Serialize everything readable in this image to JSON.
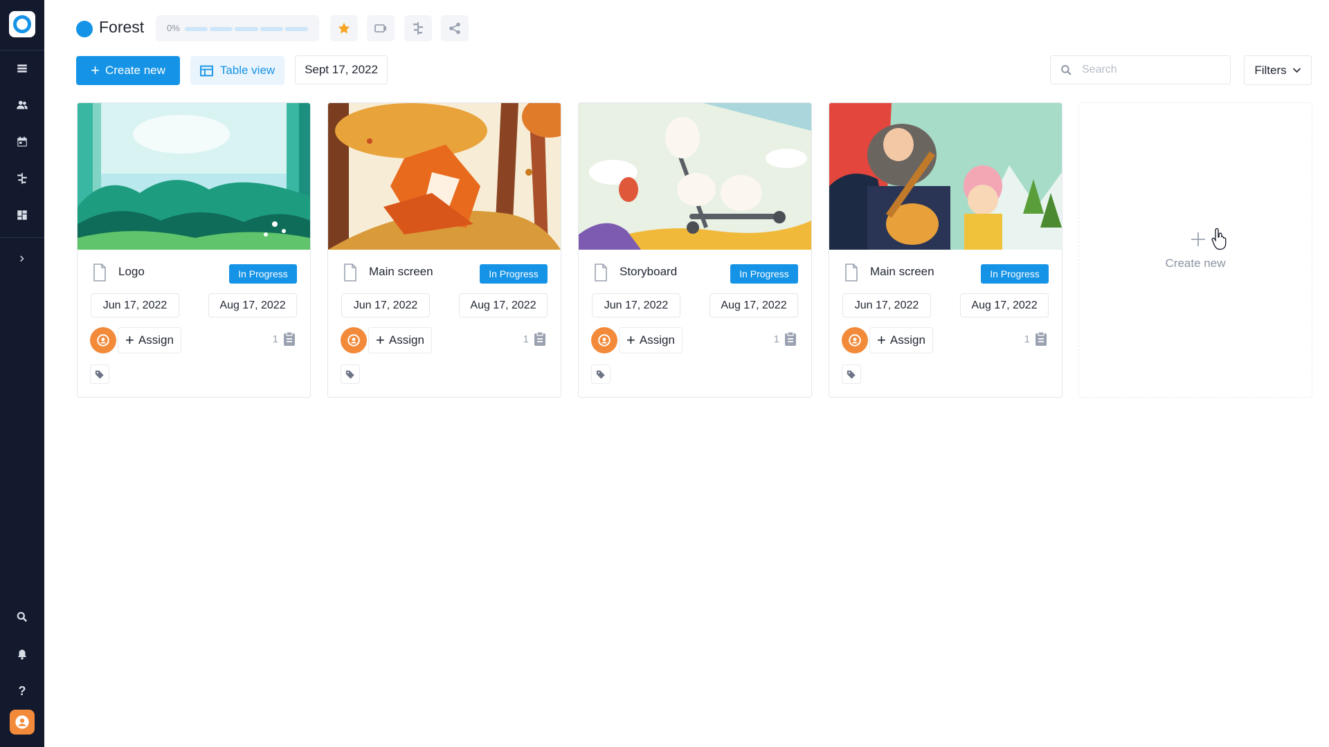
{
  "project": {
    "title": "Forest",
    "progress_label": "0%",
    "progress": 0,
    "color": "#1593e6"
  },
  "header_buttons": [
    "star-icon",
    "video-icon",
    "timeline-icon",
    "share-icon"
  ],
  "toolbar": {
    "create_label": "Create new",
    "view_label": "Table view",
    "date_label": "Sept 17, 2022"
  },
  "search": {
    "placeholder": "Search"
  },
  "filters": {
    "label": "Filters"
  },
  "sidebar": {
    "items": [
      "list-icon",
      "users-icon",
      "calendar-icon",
      "timeline-icon",
      "dashboard-icon",
      "expand-icon"
    ],
    "bottom": [
      "search-icon",
      "bell-icon",
      "help-icon",
      "avatar"
    ]
  },
  "cards": [
    {
      "title": "Logo",
      "status": "In Progress",
      "start": "Jun 17, 2022",
      "end": "Aug 17, 2022",
      "assign_label": "Assign",
      "count": "1",
      "image": "forest-landscape"
    },
    {
      "title": "Main screen",
      "status": "In Progress",
      "start": "Jun 17, 2022",
      "end": "Aug 17, 2022",
      "assign_label": "Assign",
      "count": "1",
      "image": "autumn-foxes"
    },
    {
      "title": "Storyboard",
      "status": "In Progress",
      "start": "Jun 17, 2022",
      "end": "Aug 17, 2022",
      "assign_label": "Assign",
      "count": "1",
      "image": "bunnies-scooter"
    },
    {
      "title": "Main screen",
      "status": "In Progress",
      "start": "Jun 17, 2022",
      "end": "Aug 17, 2022",
      "assign_label": "Assign",
      "count": "1",
      "image": "bear-guitar"
    }
  ],
  "create_card": {
    "label": "Create new"
  },
  "colors": {
    "sidebar": "#131a2e",
    "accent": "#1593e6",
    "avatar": "#f28a3a"
  }
}
